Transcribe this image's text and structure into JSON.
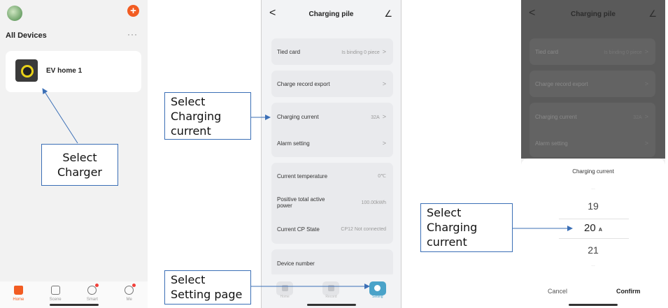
{
  "screen1": {
    "section_title": "All Devices",
    "more_label": "···",
    "add_label": "+",
    "device_name": "EV home 1",
    "tabs": [
      {
        "label": "Home",
        "icon": "home-icon"
      },
      {
        "label": "Scene",
        "icon": "scene-icon"
      },
      {
        "label": "Smart",
        "icon": "smart-icon"
      },
      {
        "label": "Me",
        "icon": "me-icon"
      }
    ]
  },
  "screen2": {
    "back": "<",
    "title": "Charging pile",
    "edit": "∠",
    "rows": [
      {
        "label": "Tied card",
        "value": "Is binding 0 piece",
        "chevron": ">"
      },
      {
        "label": "Charge record export",
        "value": "",
        "chevron": ">"
      },
      {
        "label": "Charging current",
        "value": "32A",
        "chevron": ">"
      },
      {
        "label": "Alarm setting",
        "value": "",
        "chevron": ">"
      },
      {
        "label": "Current temperature",
        "value": "0℃",
        "chevron": ""
      },
      {
        "label": "Positive total active power",
        "value": "100.00kWh",
        "chevron": ""
      },
      {
        "label": "Current CP State",
        "value": "CP12 Not connected",
        "chevron": ""
      },
      {
        "label": "Device number",
        "value": "",
        "chevron": ""
      }
    ],
    "tabs": [
      "Home",
      "Record",
      "Setting"
    ]
  },
  "screen3": {
    "title": "Charging pile",
    "sheet_title": "Charging current",
    "picker": [
      "19",
      "20",
      "21"
    ],
    "picker_faint_above": "…",
    "picker_faint_below": "…",
    "unit": "A",
    "cancel": "Cancel",
    "confirm": "Confirm"
  },
  "callouts": {
    "select_charger": [
      "Select",
      "Charger"
    ],
    "select_current_1": [
      "Select",
      "Charging",
      "current"
    ],
    "select_setting": [
      "Select",
      "Setting page"
    ],
    "select_current_2": [
      "Select",
      "Charging",
      "current"
    ]
  },
  "colors": {
    "accent_orange": "#f25c22",
    "setting_blue": "#4aa3c9",
    "callout_border": "#3b6fb6"
  }
}
